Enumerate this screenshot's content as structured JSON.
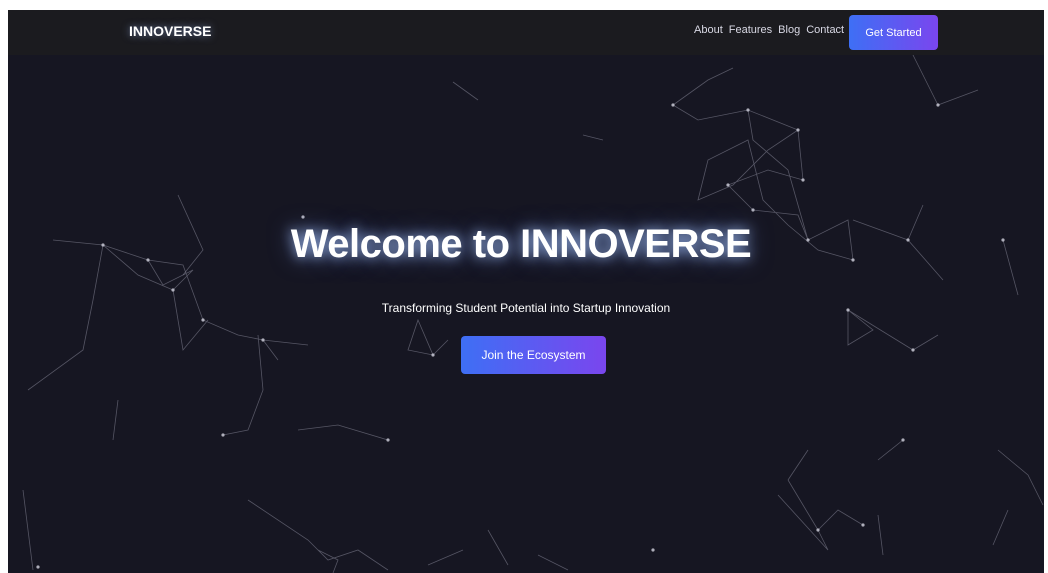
{
  "navbar": {
    "brand": "INNOVERSE",
    "links": [
      "About",
      "Features",
      "Blog",
      "Contact"
    ],
    "cta_label": "Get Started"
  },
  "hero": {
    "title": "Welcome to INNOVERSE",
    "subtitle": "Transforming Student Potential into Startup Innovation",
    "button_label": "Join the Ecosystem"
  },
  "colors": {
    "background": "#161622",
    "navbar": "#1b1b1f",
    "button_gradient_start": "#3e6ff5",
    "button_gradient_end": "#7a46ee",
    "network_lines": "#8a8a9a"
  },
  "icons": [
    "particle-network-background"
  ]
}
